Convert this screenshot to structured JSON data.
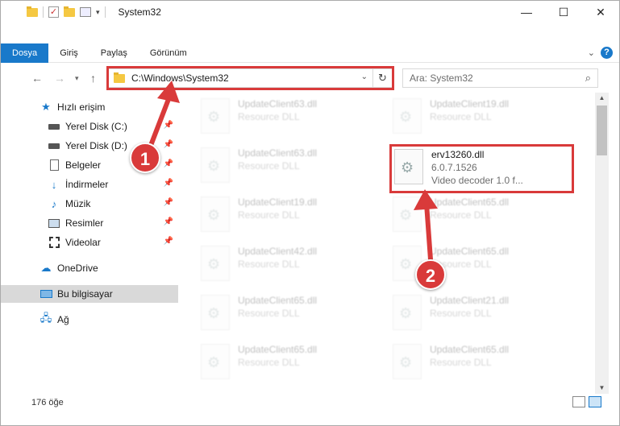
{
  "window": {
    "title": "System32",
    "minimize": "—",
    "maximize": "☐",
    "close": "✕"
  },
  "ribbon": {
    "tabs": [
      "Dosya",
      "Giriş",
      "Paylaş",
      "Görünüm"
    ],
    "help": "?"
  },
  "address": {
    "path": "C:\\Windows\\System32",
    "search_placeholder": "Ara: System32"
  },
  "sidebar": {
    "items": [
      {
        "label": "Hızlı erişim",
        "icon": "star-icon"
      },
      {
        "label": "Yerel Disk (C:)",
        "icon": "drive-icon"
      },
      {
        "label": "Yerel Disk (D:)",
        "icon": "drive-icon"
      },
      {
        "label": "Belgeler",
        "icon": "document-icon"
      },
      {
        "label": "İndirmeler",
        "icon": "download-icon"
      },
      {
        "label": "Müzik",
        "icon": "music-icon"
      },
      {
        "label": "Resimler",
        "icon": "pictures-icon"
      },
      {
        "label": "Videolar",
        "icon": "video-icon"
      },
      {
        "label": "OneDrive",
        "icon": "cloud-icon"
      },
      {
        "label": "Bu bilgisayar",
        "icon": "computer-icon"
      },
      {
        "label": "Ağ",
        "icon": "network-icon"
      }
    ]
  },
  "files": {
    "left": [
      {
        "name": "UpdateClient63.dll",
        "sub": "Resource DLL"
      },
      {
        "name": "UpdateClient63.dll",
        "sub": "Resource DLL"
      },
      {
        "name": "UpdateClient19.dll",
        "sub": "Resource DLL"
      },
      {
        "name": "UpdateClient42.dll",
        "sub": "Resource DLL"
      },
      {
        "name": "UpdateClient65.dll",
        "sub": "Resource DLL"
      },
      {
        "name": "UpdateClient65.dll",
        "sub": "Resource DLL"
      }
    ],
    "right": [
      {
        "name": "UpdateClient19.dll",
        "sub": "Resource DLL"
      },
      {
        "name": "UpdateClient65.dll",
        "sub": "Resource DLL"
      },
      {
        "name": "UpdateClient65.dll",
        "sub": "Resource DLL"
      },
      {
        "name": "UpdateClient21.dll",
        "sub": "Resource DLL"
      },
      {
        "name": "UpdateClient65.dll",
        "sub": "Resource DLL"
      }
    ],
    "highlighted": {
      "name": "erv13260.dll",
      "version": "6.0.7.1526",
      "desc": "Video decoder 1.0 f..."
    }
  },
  "status": {
    "count": "176 öğe"
  },
  "callouts": {
    "one": "1",
    "two": "2",
    "color": "#d93a3a"
  },
  "colors": {
    "accent": "#1979ca"
  }
}
